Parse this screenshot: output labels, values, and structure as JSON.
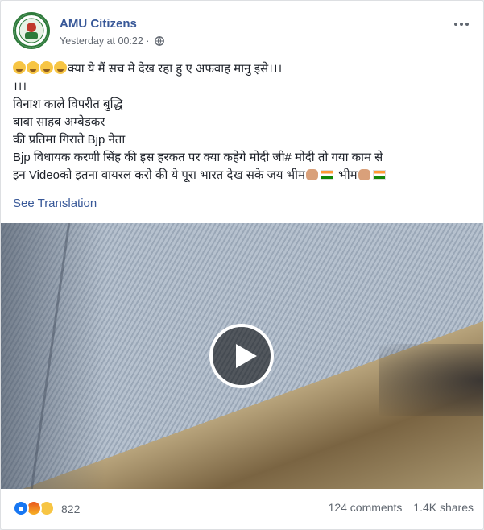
{
  "post": {
    "page_name": "AMU Citizens",
    "timestamp": "Yesterday at 00:22",
    "separator": "·",
    "privacy_icon": "globe-icon",
    "more_icon": "ellipsis-icon",
    "lines": [
      {
        "prefix_emojis": 4,
        "text": "क्या ये मैं सच मे देख रहा हु ए अफवाह मानु इसे।।।"
      },
      {
        "text": "।।।"
      },
      {
        "text": "विनाश काले विपरीत बुद्धि"
      },
      {
        "text": "बाबा साहब अम्बेडकर"
      },
      {
        "text": "की प्रतिमा गिराते Bjp नेता"
      },
      {
        "text": "Bjp विधायक करणी सिंह की इस हरकत पर क्या कहेगे मोदी जी# मोदी तो गया काम से"
      },
      {
        "text_a": "इन Videoको इतना वायरल करो की ये पूरा भारत देख सके जय भीम",
        "text_b": " भीम"
      }
    ],
    "see_translation": "See Translation",
    "video": {
      "play_icon": "play-icon"
    },
    "reactions": {
      "icons": [
        "like-icon",
        "angry-icon",
        "sad-icon"
      ],
      "count": "822"
    },
    "comments": "124 comments",
    "shares": "1.4K shares"
  },
  "colors": {
    "link": "#385898",
    "meta": "#616770",
    "like": "#1877f2"
  }
}
